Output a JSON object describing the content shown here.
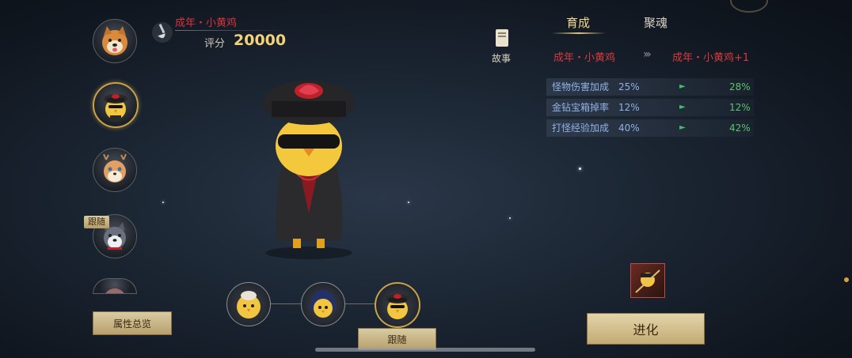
{
  "pet_list": {
    "items": [
      {
        "icon": "shiba-dog-icon",
        "selected": false
      },
      {
        "icon": "officer-chick-icon",
        "selected": true
      },
      {
        "icon": "deer-fox-icon",
        "selected": false
      },
      {
        "icon": "husky-icon",
        "selected": false,
        "tag": "跟随"
      },
      {
        "icon": "partial-pet-icon",
        "selected": false
      }
    ],
    "overview_label": "属性总览"
  },
  "header": {
    "pet_name": "成年・小黄鸡",
    "score_label": "评分",
    "score_value": "20000"
  },
  "story": {
    "label": "故事"
  },
  "tabs": [
    {
      "label": "育成",
      "active": true
    },
    {
      "label": "聚魂",
      "active": false
    }
  ],
  "evolution": {
    "from": "成年・小黄鸡",
    "arrows": "›››",
    "to": "成年・小黄鸡+1"
  },
  "stats": [
    {
      "name": "怪物伤害加成",
      "current": "25%",
      "next": "28%"
    },
    {
      "name": "金钻宝箱掉率",
      "current": "12%",
      "next": "12%"
    },
    {
      "name": "打怪经验加成",
      "current": "40%",
      "next": "42%"
    }
  ],
  "forms": {
    "items": [
      {
        "icon": "baby-chick-icon",
        "selected": false
      },
      {
        "icon": "hooded-chick-icon",
        "selected": false
      },
      {
        "icon": "officer-chick-icon",
        "selected": true
      }
    ],
    "follow_label": "跟随"
  },
  "evolve_button": "进化",
  "colors": {
    "accent_gold": "#f3d27a",
    "name_red": "#d73a3e",
    "stat_blue": "#8fb3e6",
    "stat_green": "#5ec46f"
  }
}
